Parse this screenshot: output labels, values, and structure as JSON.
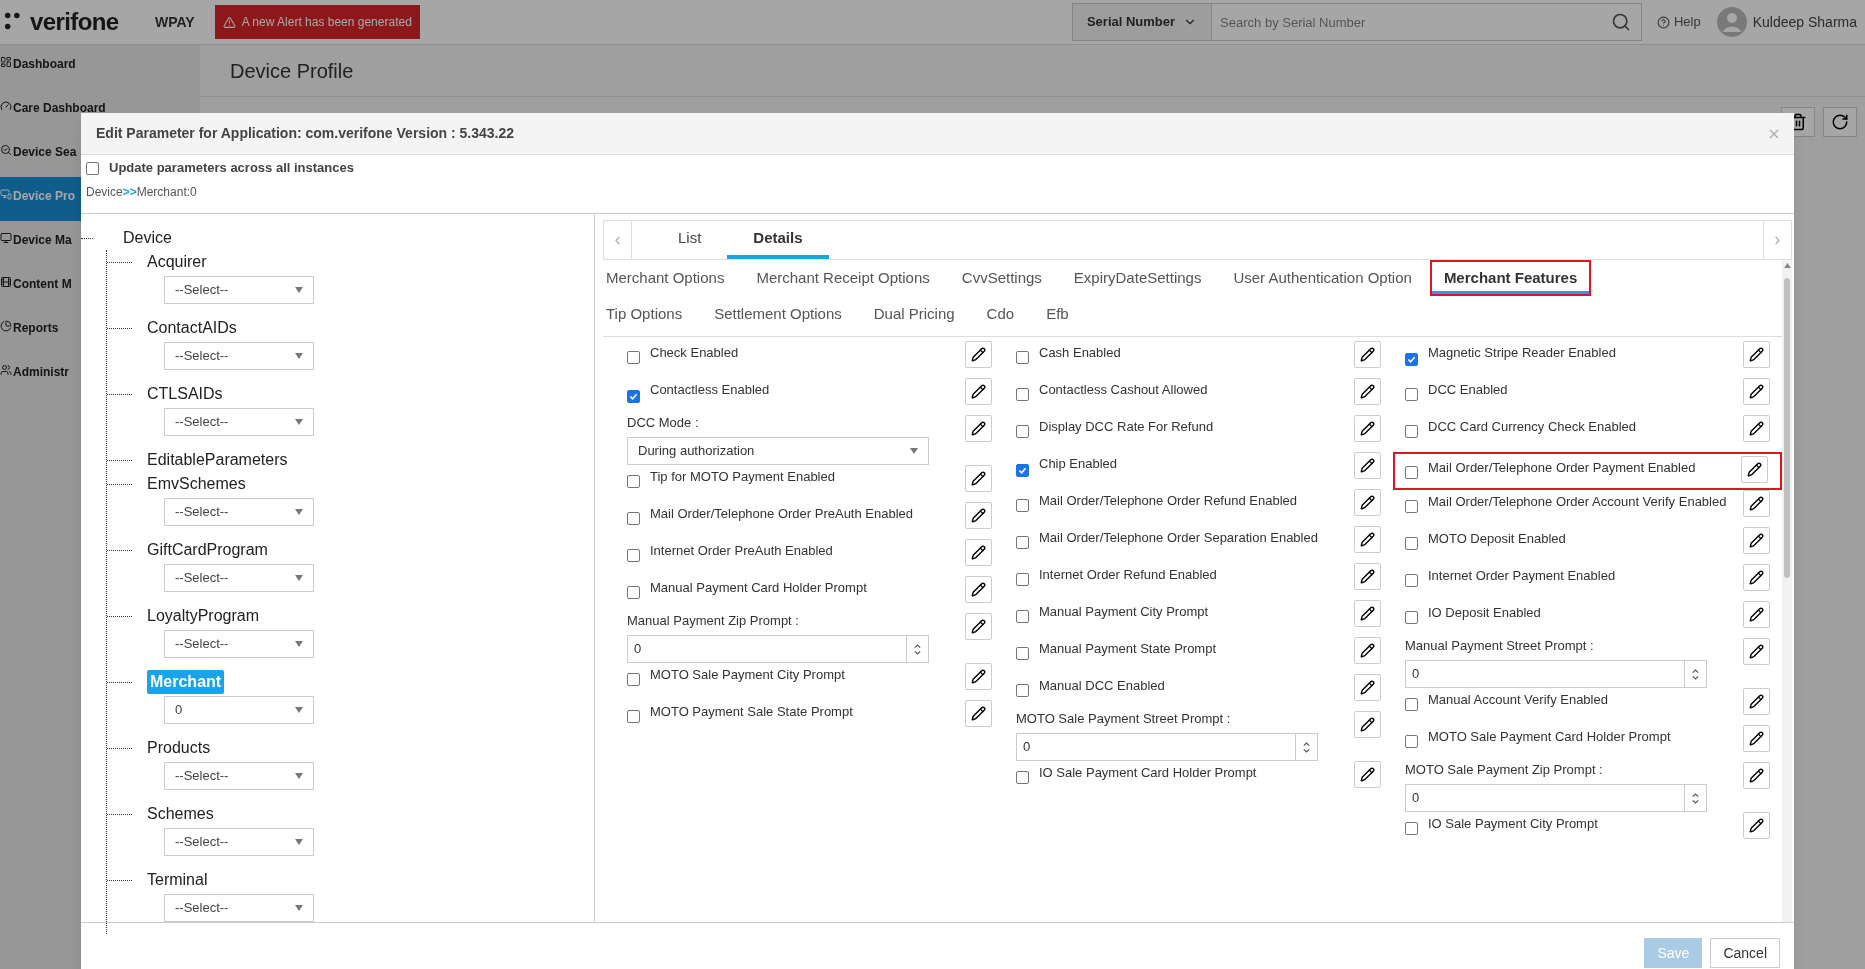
{
  "app": {
    "logo": "verifone",
    "product": "WPAY",
    "alert": "A new Alert has been generated",
    "search_scope": "Serial Number",
    "search_placeholder": "Search by Serial Number",
    "help": "Help",
    "user": "Kuldeep Sharma"
  },
  "sidebar": [
    {
      "label": "Dashboard",
      "selected": false
    },
    {
      "label": "Care Dashboard",
      "selected": false
    },
    {
      "label": "Device Sea",
      "selected": false
    },
    {
      "label": "Device Pro",
      "selected": true
    },
    {
      "label": "Device Ma",
      "selected": false
    },
    {
      "label": "Content M",
      "selected": false
    },
    {
      "label": "Reports",
      "selected": false
    },
    {
      "label": "Administr",
      "selected": false
    }
  ],
  "page_title": "Device Profile",
  "dialog": {
    "title": "Edit Parameter for Application: com.verifone Version : 5.343.22",
    "update_all": {
      "label": "Update parameters across all instances",
      "checked": false
    },
    "breadcrumb": [
      "Device",
      "Merchant:0"
    ],
    "breadcrumb_separator": ">>",
    "tree": {
      "label": "Device",
      "children": [
        {
          "label": "Acquirer",
          "value": "--Select--",
          "selected": false
        },
        {
          "label": "ContactAIDs",
          "value": "--Select--",
          "selected": false
        },
        {
          "label": "CTLSAIDs",
          "value": "--Select--",
          "selected": false
        },
        {
          "label": "EditableParameters",
          "selected": false
        },
        {
          "label": "EmvSchemes",
          "value": "--Select--",
          "selected": false
        },
        {
          "label": "GiftCardProgram",
          "value": "--Select--",
          "selected": false
        },
        {
          "label": "LoyaltyProgram",
          "value": "--Select--",
          "selected": false
        },
        {
          "label": "Merchant",
          "value": "0",
          "selected": true
        },
        {
          "label": "Products",
          "value": "--Select--",
          "selected": false
        },
        {
          "label": "Schemes",
          "value": "--Select--",
          "selected": false
        },
        {
          "label": "Terminal",
          "value": "--Select--",
          "selected": false
        }
      ]
    },
    "view_tabs": [
      {
        "label": "List",
        "selected": false
      },
      {
        "label": "Details",
        "selected": true
      }
    ],
    "section_tabs": [
      [
        {
          "label": "Merchant Options",
          "selected": false
        },
        {
          "label": "Merchant Receipt Options",
          "selected": false
        },
        {
          "label": "CvvSettings",
          "selected": false
        },
        {
          "label": "ExpiryDateSettings",
          "selected": false
        },
        {
          "label": "User Authentication Option",
          "selected": false
        },
        {
          "label": "Merchant Features",
          "selected": true
        }
      ],
      [
        {
          "label": "Tip Options",
          "selected": false
        },
        {
          "label": "Settlement Options",
          "selected": false
        },
        {
          "label": "Dual Pricing",
          "selected": false
        },
        {
          "label": "Cdo",
          "selected": false
        },
        {
          "label": "Efb",
          "selected": false
        }
      ]
    ],
    "columns": [
      [
        {
          "kind": "checkbox",
          "label": "Check Enabled",
          "checked": false
        },
        {
          "kind": "checkbox",
          "label": "Contactless Enabled",
          "checked": true
        },
        {
          "kind": "select",
          "label": "DCC Mode :",
          "value": "During authorization"
        },
        {
          "kind": "checkbox",
          "label": "Tip for MOTO Payment Enabled",
          "checked": false
        },
        {
          "kind": "checkbox",
          "label": "Mail Order/Telephone Order PreAuth Enabled",
          "checked": false
        },
        {
          "kind": "checkbox",
          "label": "Internet Order PreAuth Enabled",
          "checked": false
        },
        {
          "kind": "checkbox",
          "label": "Manual Payment Card Holder Prompt",
          "checked": false
        },
        {
          "kind": "number",
          "label": "Manual Payment Zip Prompt :",
          "value": "0"
        },
        {
          "kind": "checkbox",
          "label": "MOTO Sale Payment City Prompt",
          "checked": false
        },
        {
          "kind": "checkbox",
          "label": "MOTO Payment Sale State Prompt",
          "checked": false
        }
      ],
      [
        {
          "kind": "checkbox",
          "label": "Cash Enabled",
          "checked": false
        },
        {
          "kind": "checkbox",
          "label": "Contactless Cashout Allowed",
          "checked": false
        },
        {
          "kind": "checkbox",
          "label": "Display DCC Rate For Refund",
          "checked": false
        },
        {
          "kind": "checkbox",
          "label": "Chip Enabled",
          "checked": true
        },
        {
          "kind": "checkbox",
          "label": "Mail Order/Telephone Order Refund Enabled",
          "checked": false
        },
        {
          "kind": "checkbox",
          "label": "Mail Order/Telephone Order Separation Enabled",
          "checked": false
        },
        {
          "kind": "checkbox",
          "label": "Internet Order Refund Enabled",
          "checked": false
        },
        {
          "kind": "checkbox",
          "label": "Manual Payment City Prompt",
          "checked": false
        },
        {
          "kind": "checkbox",
          "label": "Manual Payment State Prompt",
          "checked": false
        },
        {
          "kind": "checkbox",
          "label": "Manual DCC Enabled",
          "checked": false
        },
        {
          "kind": "number",
          "label": "MOTO Sale Payment Street Prompt :",
          "value": "0"
        },
        {
          "kind": "checkbox",
          "label": "IO Sale Payment Card Holder Prompt",
          "checked": false
        }
      ],
      [
        {
          "kind": "checkbox",
          "label": "Magnetic Stripe Reader Enabled",
          "checked": true
        },
        {
          "kind": "checkbox",
          "label": "DCC Enabled",
          "checked": false
        },
        {
          "kind": "checkbox",
          "label": "DCC Card Currency Check Enabled",
          "checked": false
        },
        {
          "kind": "checkbox",
          "label": "Mail Order/Telephone Order Payment Enabled",
          "checked": false,
          "highlighted": true
        },
        {
          "kind": "checkbox",
          "label": "Mail Order/Telephone Order Account Verify Enabled",
          "checked": false
        },
        {
          "kind": "checkbox",
          "label": "MOTO Deposit Enabled",
          "checked": false
        },
        {
          "kind": "checkbox",
          "label": "Internet Order Payment Enabled",
          "checked": false
        },
        {
          "kind": "checkbox",
          "label": "IO Deposit Enabled",
          "checked": false
        },
        {
          "kind": "number",
          "label": "Manual Payment Street Prompt :",
          "value": "0"
        },
        {
          "kind": "checkbox",
          "label": "Manual Account Verify Enabled",
          "checked": false
        },
        {
          "kind": "checkbox",
          "label": "MOTO Sale Payment Card Holder Prompt",
          "checked": false
        },
        {
          "kind": "number",
          "label": "MOTO Sale Payment Zip Prompt :",
          "value": "0"
        },
        {
          "kind": "checkbox",
          "label": "IO Sale Payment City Prompt",
          "checked": false
        }
      ]
    ],
    "buttons": [
      {
        "label": "Save",
        "disabled": true
      },
      {
        "label": "Cancel",
        "disabled": false
      }
    ]
  }
}
